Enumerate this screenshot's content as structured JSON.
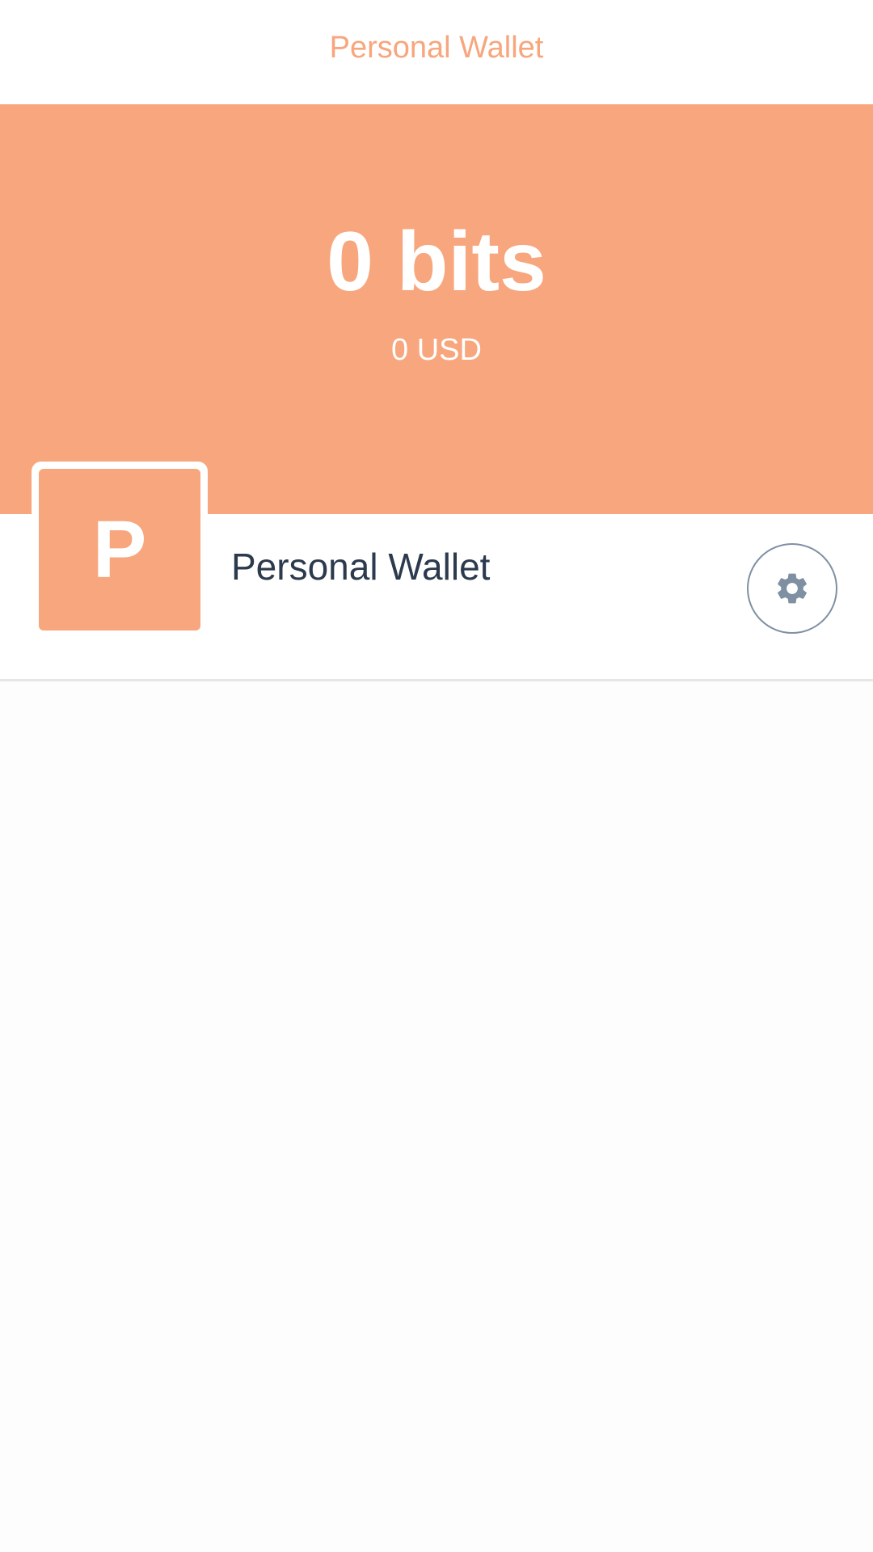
{
  "header": {
    "title": "Personal Wallet"
  },
  "balance": {
    "primary": "0 bits",
    "secondary": "0 USD"
  },
  "wallet": {
    "avatar_letter": "P",
    "name": "Personal Wallet",
    "settings_icon": "gear-icon"
  },
  "colors": {
    "accent": "#f7a67d",
    "text_dark": "#2b3a4d",
    "icon_gray": "#7f90a3",
    "divider": "#e6e6e6"
  }
}
